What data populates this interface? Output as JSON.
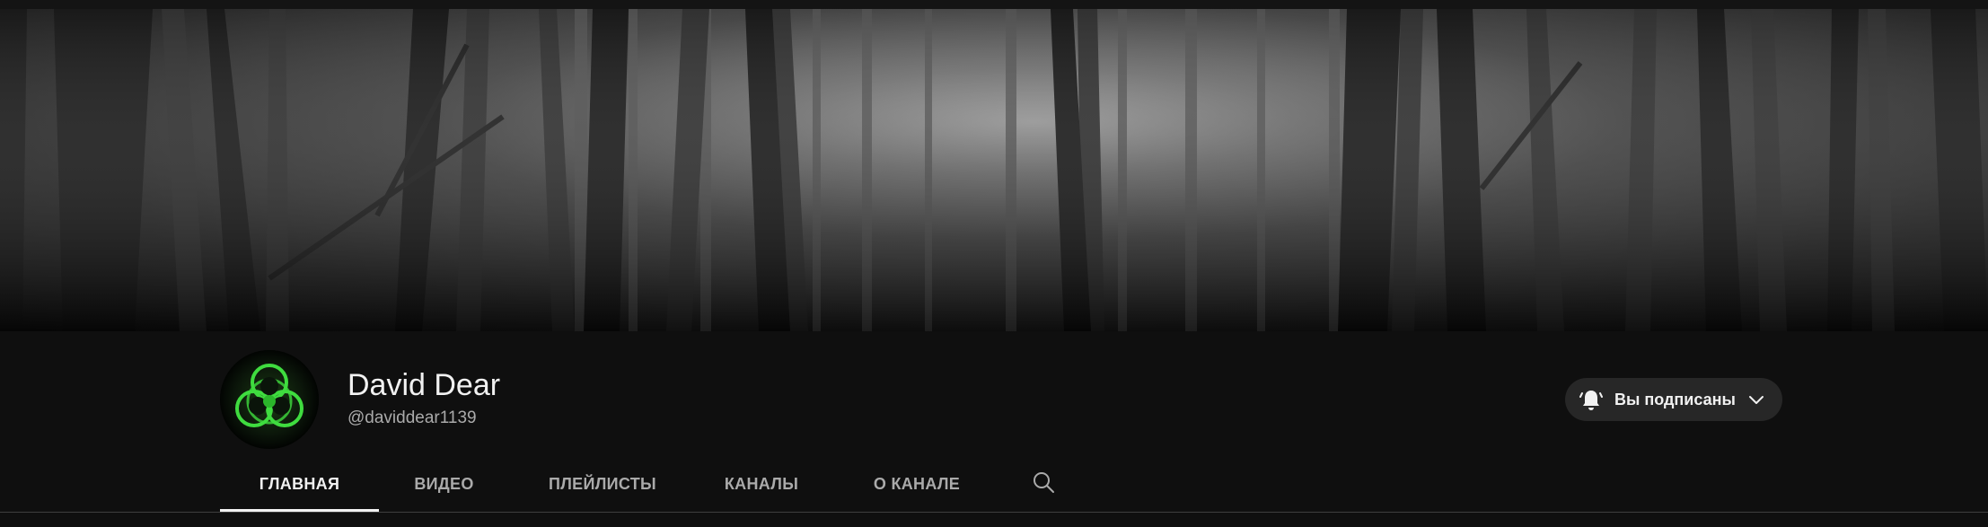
{
  "channel": {
    "name": "David Dear",
    "handle": "@daviddear1139"
  },
  "subscribe": {
    "label": "Вы подписаны",
    "icon": "bell-ringing-icon",
    "dropdown_icon": "chevron-down-icon"
  },
  "tabs": [
    {
      "label": "ГЛАВНАЯ",
      "active": true
    },
    {
      "label": "ВИДЕО",
      "active": false
    },
    {
      "label": "ПЛЕЙЛИСТЫ",
      "active": false
    },
    {
      "label": "КАНАЛЫ",
      "active": false
    },
    {
      "label": "О КАНАЛЕ",
      "active": false
    }
  ],
  "search_icon": "search-icon",
  "colors": {
    "background": "#0f0f0f",
    "button_bg": "#272727",
    "text_primary": "#f1f1f1",
    "text_secondary": "#aaaaaa",
    "avatar_green": "#38d43a"
  }
}
